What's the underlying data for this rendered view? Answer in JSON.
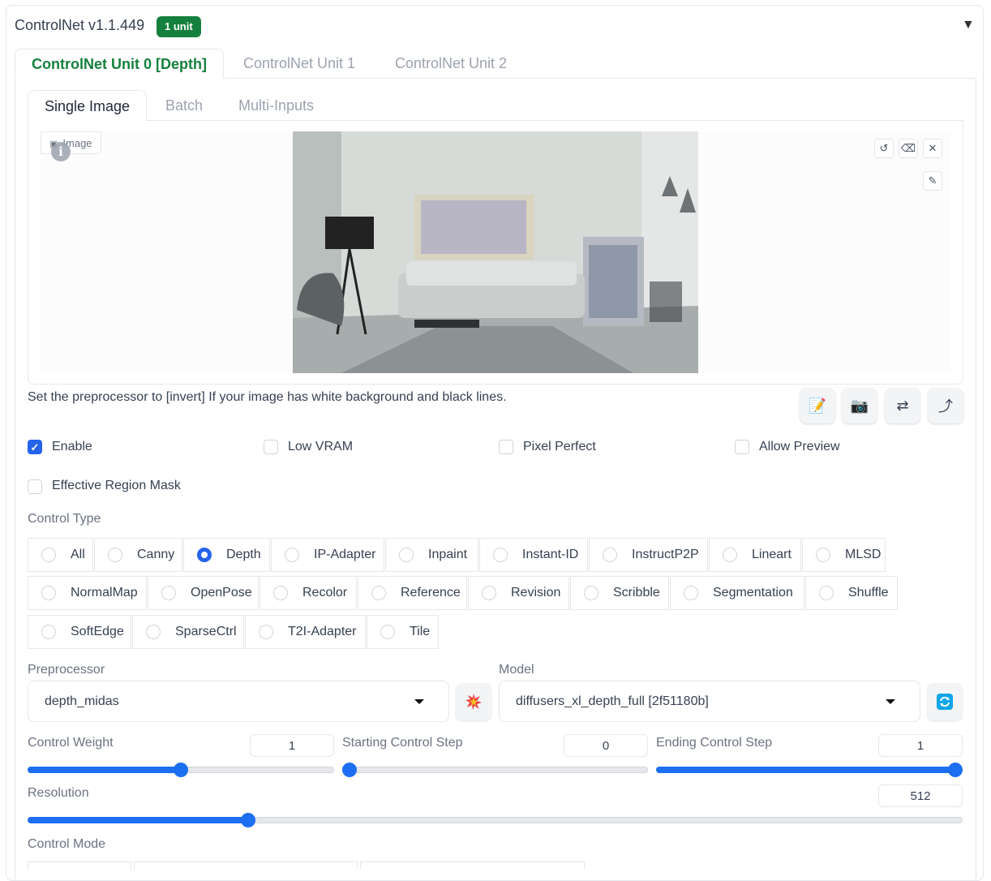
{
  "header": {
    "title": "ControlNet v1.1.449",
    "badge": "1 unit"
  },
  "unit_tabs": [
    "ControlNet Unit 0 [Depth]",
    "ControlNet Unit 1",
    "ControlNet Unit 2"
  ],
  "image_tabs": [
    "Single Image",
    "Batch",
    "Multi-Inputs"
  ],
  "image_panel": {
    "label": "Image"
  },
  "hint": "Set the preprocessor to [invert] If your image has white background and black lines.",
  "checkboxes": {
    "enable": {
      "label": "Enable",
      "checked": true
    },
    "low_vram": {
      "label": "Low VRAM",
      "checked": false
    },
    "pixel_perfect": {
      "label": "Pixel Perfect",
      "checked": false
    },
    "allow_preview": {
      "label": "Allow Preview",
      "checked": false
    },
    "effective_region_mask": {
      "label": "Effective Region Mask",
      "checked": false
    }
  },
  "control_type": {
    "label": "Control Type",
    "selected": "Depth",
    "options": [
      "All",
      "Canny",
      "Depth",
      "IP-Adapter",
      "Inpaint",
      "Instant-ID",
      "InstructP2P",
      "Lineart",
      "MLSD",
      "NormalMap",
      "OpenPose",
      "Recolor",
      "Reference",
      "Revision",
      "Scribble",
      "Segmentation",
      "Shuffle",
      "SoftEdge",
      "SparseCtrl",
      "T2I-Adapter",
      "Tile"
    ]
  },
  "preprocessor": {
    "label": "Preprocessor",
    "value": "depth_midas"
  },
  "model": {
    "label": "Model",
    "value": "diffusers_xl_depth_full [2f51180b]"
  },
  "sliders": {
    "control_weight": {
      "label": "Control Weight",
      "value": "1",
      "fraction": 0.5
    },
    "starting_step": {
      "label": "Starting Control Step",
      "value": "0",
      "fraction": 0.0
    },
    "ending_step": {
      "label": "Ending Control Step",
      "value": "1",
      "fraction": 1.0
    },
    "resolution": {
      "label": "Resolution",
      "value": "512",
      "fraction": 0.232
    }
  },
  "control_mode": {
    "label": "Control Mode"
  },
  "colors": {
    "accent_green": "#15803d",
    "accent_blue": "#2563eb",
    "slider_blue": "#1d6ff2"
  }
}
